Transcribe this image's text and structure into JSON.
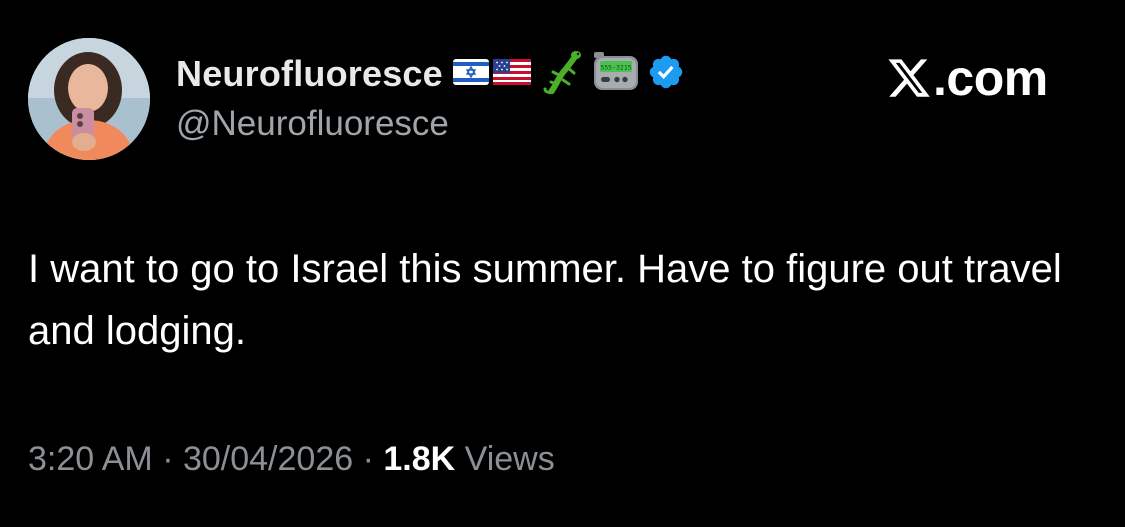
{
  "author": {
    "display_name": "Neurofluoresce",
    "handle": "@Neurofluoresce",
    "name_emojis": [
      "israel-flag-emoji",
      "us-flag-emoji",
      "lizard-emoji",
      "pager-emoji"
    ],
    "pager_text": "555-3215",
    "verified": true,
    "verified_color": "#1d9bf0"
  },
  "brand": {
    "text": ".com"
  },
  "tweet": {
    "text": "I want to go to Israel this summer. Have to figure out travel and lodging."
  },
  "meta": {
    "time": "3:20 AM",
    "separator1": " · ",
    "date": "30/04/2026",
    "separator2": " · ",
    "views_count": "1.8K",
    "views_label": " Views"
  },
  "colors": {
    "background": "#000000",
    "text_primary": "#ffffff",
    "text_secondary": "#8b9095"
  }
}
